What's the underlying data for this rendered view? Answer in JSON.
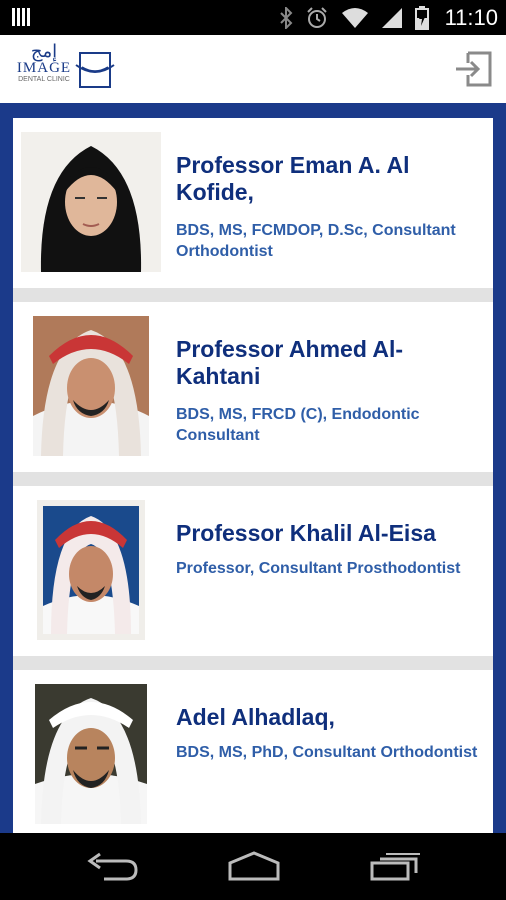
{
  "status_bar": {
    "time": "11:10",
    "icons": [
      "bluetooth-icon",
      "alarm-icon",
      "wifi-icon",
      "signal-icon",
      "battery-charging-icon"
    ]
  },
  "header": {
    "logo_arabic": "إمج",
    "logo_name": "IMAGE",
    "logo_tagline": "DENTAL CLINIC",
    "logout_icon": "logout-icon"
  },
  "doctors": [
    {
      "name": "Professor Eman A. Al Kofide,",
      "qualifications": "BDS, MS, FCMDOP, D.Sc, Consultant Orthodontist"
    },
    {
      "name": "Professor Ahmed Al-Kahtani",
      "qualifications": "BDS, MS, FRCD (C), Endodontic Consultant"
    },
    {
      "name": "Professor Khalil Al-Eisa",
      "qualifications": "Professor, Consultant Prosthodontist"
    },
    {
      "name": "Adel Alhadlaq,",
      "qualifications": "BDS, MS, PhD, Consultant Orthodontist"
    }
  ],
  "nav": {
    "back": "back-icon",
    "home": "home-icon",
    "recents": "recents-icon"
  },
  "colors": {
    "brand_blue": "#1b3a8a",
    "name_blue": "#0f2f7c",
    "qual_blue": "#2f5ea8"
  }
}
